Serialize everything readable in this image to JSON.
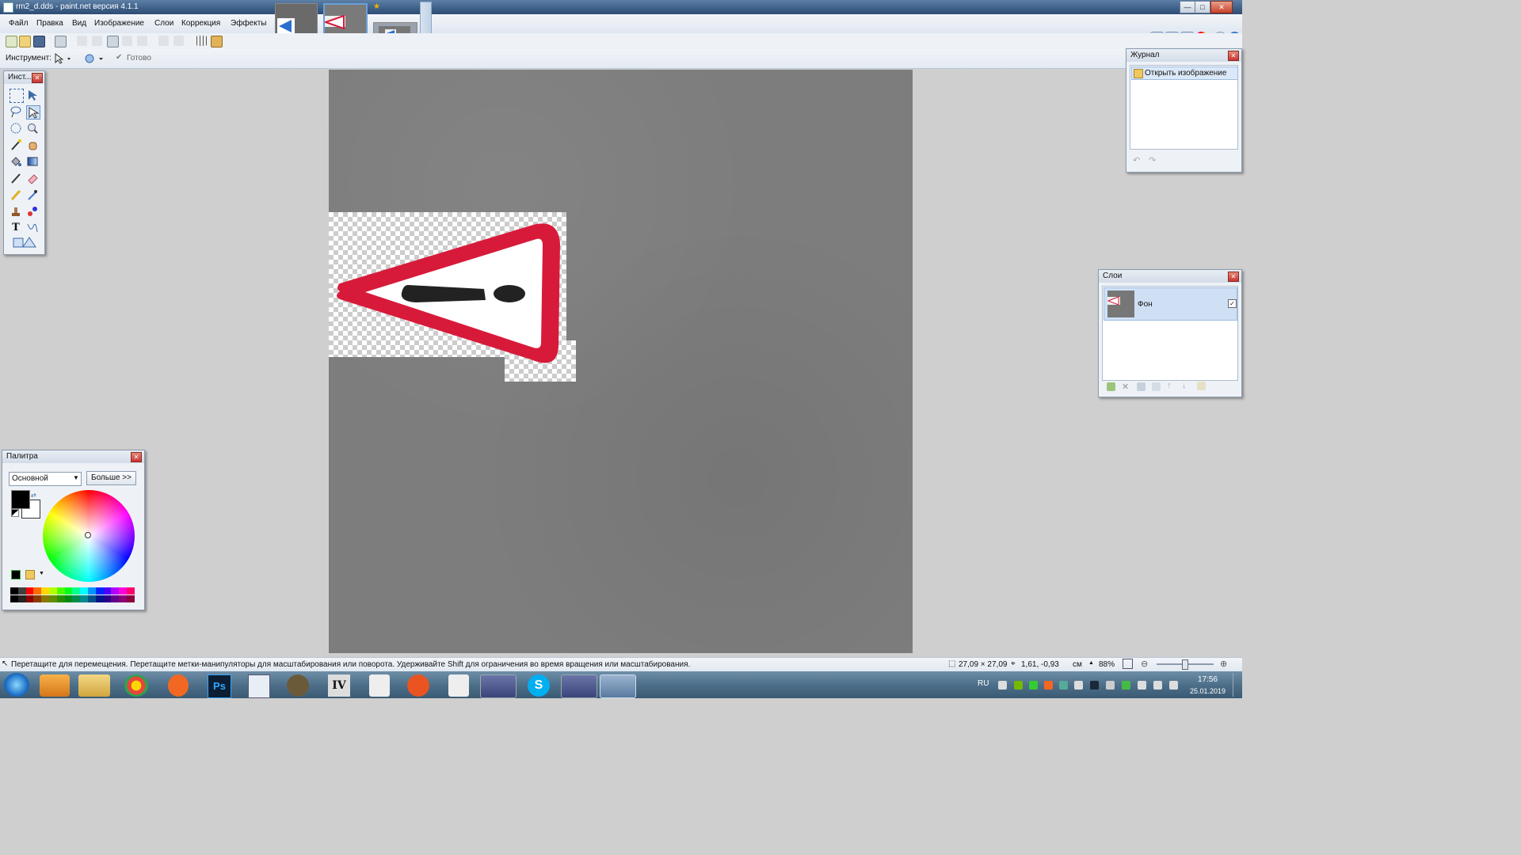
{
  "window": {
    "title": "rm2_d.dds - paint.net версия 4.1.1",
    "buttons": {
      "minimize": "—",
      "maximize": "□",
      "close": "✕"
    }
  },
  "menu": {
    "items": [
      "Файл",
      "Правка",
      "Вид",
      "Изображение",
      "Слои",
      "Коррекция",
      "Эффекты"
    ]
  },
  "toolbar2": {
    "tool_label": "Инструмент:",
    "done_label": "Готово"
  },
  "tools_panel": {
    "title": "Инст..."
  },
  "history_panel": {
    "title": "Журнал",
    "items": [
      "Открыть изображение"
    ]
  },
  "layers_panel": {
    "title": "Слои",
    "layers": [
      {
        "name": "Фон",
        "visible": true
      }
    ]
  },
  "palette_panel": {
    "title": "Палитра",
    "mode_select": "Основной",
    "more_button": "Больше >>",
    "primary_color": "#000000",
    "secondary_color": "#ffffff",
    "swatches": [
      "#000000",
      "#404040",
      "#ff0000",
      "#ff6a00",
      "#ffd800",
      "#b6ff00",
      "#4cff00",
      "#00ff21",
      "#00ff90",
      "#00ffff",
      "#0094ff",
      "#0026ff",
      "#4800ff",
      "#b200ff",
      "#ff00dc",
      "#ff006e"
    ]
  },
  "status": {
    "hint": "Перетащите для перемещения. Перетащите метки-манипуляторы для масштабирования или поворота. Удерживайте Shift для ограничения во время вращения или масштабирования.",
    "size": "27,09 × 27,09",
    "coords": "1,61, -0,93",
    "units": "см",
    "zoom": "88%"
  },
  "taskbar": {
    "lang": "RU",
    "time": "17:56",
    "date": "25.01.2019",
    "apps": [
      "start-orb",
      "media-player",
      "file-explorer",
      "chrome",
      "origin",
      "photoshop",
      "paint-net",
      "gimp",
      "nfs",
      "need-for-speed",
      "ubuntu",
      "nfs-2",
      "obs",
      "skype",
      "discord",
      "paint-net-active"
    ]
  },
  "colors": {
    "sign_red": "#d81a3a",
    "sign_white": "#ffffff",
    "sign_black": "#222222",
    "asphalt": "#7d7d7d"
  }
}
